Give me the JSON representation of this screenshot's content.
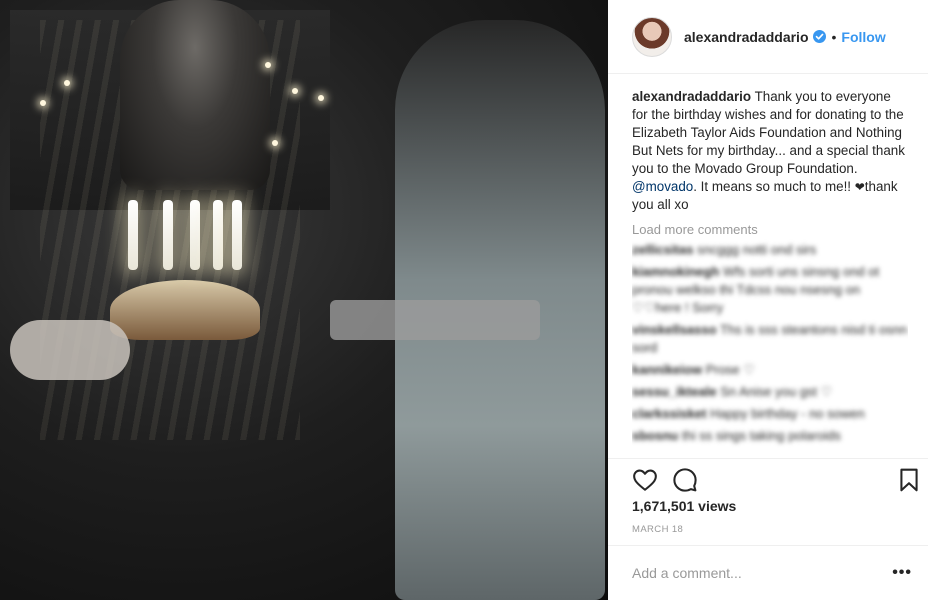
{
  "post": {
    "media": {
      "description_icon": "video-still"
    },
    "header": {
      "username": "alexandradaddario",
      "verified_icon": "verified-badge-icon",
      "separator": "•",
      "follow_label": "Follow"
    },
    "caption": {
      "username": "alexandradaddario",
      "text_before_mention": "Thank you to everyone for the birthday wishes and for donating to the Elizabeth Taylor Aids Foundation and Nothing But Nets for my birthday... and a special thank you to the Movado Group Foundation.",
      "mention": "@movado",
      "text_after_mention": ". It means so much to me!! ",
      "heart": "❤",
      "text_end": "thank you all xo"
    },
    "load_more_label": "Load more comments",
    "comments": [
      {
        "username": "zellicsitas",
        "text": "sncggg notti ond sirs"
      },
      {
        "username": "kiamnokinegh",
        "text": "Wfs sorti uns sinsng ond ot pronou welkso thi Tdcss nou nsesng on ♡♡here ! Sorry"
      },
      {
        "username": "vinskellsasso",
        "text": "Ths is sss steantons nisd ti osnn sord"
      },
      {
        "username": "kannikeiow",
        "text": "Prose ♡"
      },
      {
        "username": "sessu_ikteale",
        "text": "Sn Anise you gst ♡"
      },
      {
        "username": "clarkssisket",
        "text": "Happy birthday - no sowen"
      },
      {
        "username": "sbosnu",
        "text": "thi ss sings taking polaroids"
      }
    ],
    "actions": {
      "like_icon": "heart-outline-icon",
      "comment_icon": "comment-bubble-icon",
      "save_icon": "bookmark-outline-icon"
    },
    "views": "1,671,501 views",
    "date": "MARCH 18",
    "add_comment_placeholder": "Add a comment...",
    "more_options": "•••",
    "colors": {
      "accent": "#3897f0",
      "mention": "#003569",
      "muted": "#999999"
    }
  }
}
